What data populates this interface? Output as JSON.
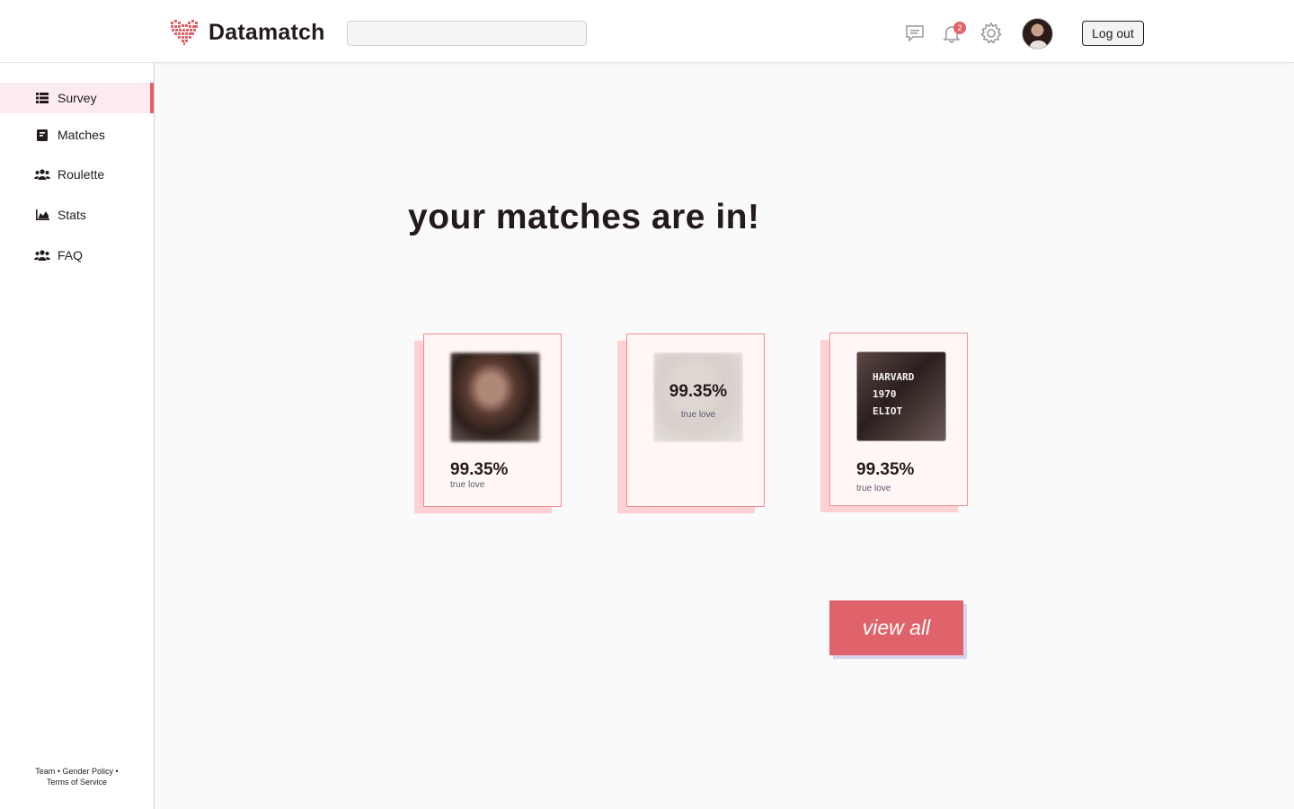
{
  "header": {
    "brand": "Datamatch",
    "search_placeholder": "",
    "icons": [
      "message-icon",
      "bell-icon",
      "gear-icon"
    ],
    "notification_count": "2",
    "logout_label": "Log out"
  },
  "sidebar": {
    "items": [
      {
        "label": "Survey",
        "icon": "table-list-icon",
        "active": true
      },
      {
        "label": "Matches",
        "icon": "document-icon",
        "active": false
      },
      {
        "label": "Roulette",
        "icon": "users-icon",
        "active": false
      },
      {
        "label": "Stats",
        "icon": "area-chart-icon",
        "active": false
      },
      {
        "label": "FAQ",
        "icon": "users-icon",
        "active": false
      }
    ],
    "footer": {
      "team": "Team",
      "gender_policy": "Gender Policy",
      "terms": "Terms of Service",
      "separator": "•"
    }
  },
  "main": {
    "headline": "your matches are in!",
    "matches": [
      {
        "percent": "99.35%",
        "label": "true love"
      },
      {
        "percent": "99.35%",
        "label": "true love"
      },
      {
        "percent": "99.35%",
        "label": "true love",
        "overlay": [
          "HARVARD",
          "1970",
          "ELIOT"
        ]
      }
    ],
    "view_all_label": "view all"
  },
  "colors": {
    "accent": "#e0636b",
    "card_shadow": "#ffd1d3",
    "card_bg": "#fff6f6",
    "text": "#231a1c"
  }
}
